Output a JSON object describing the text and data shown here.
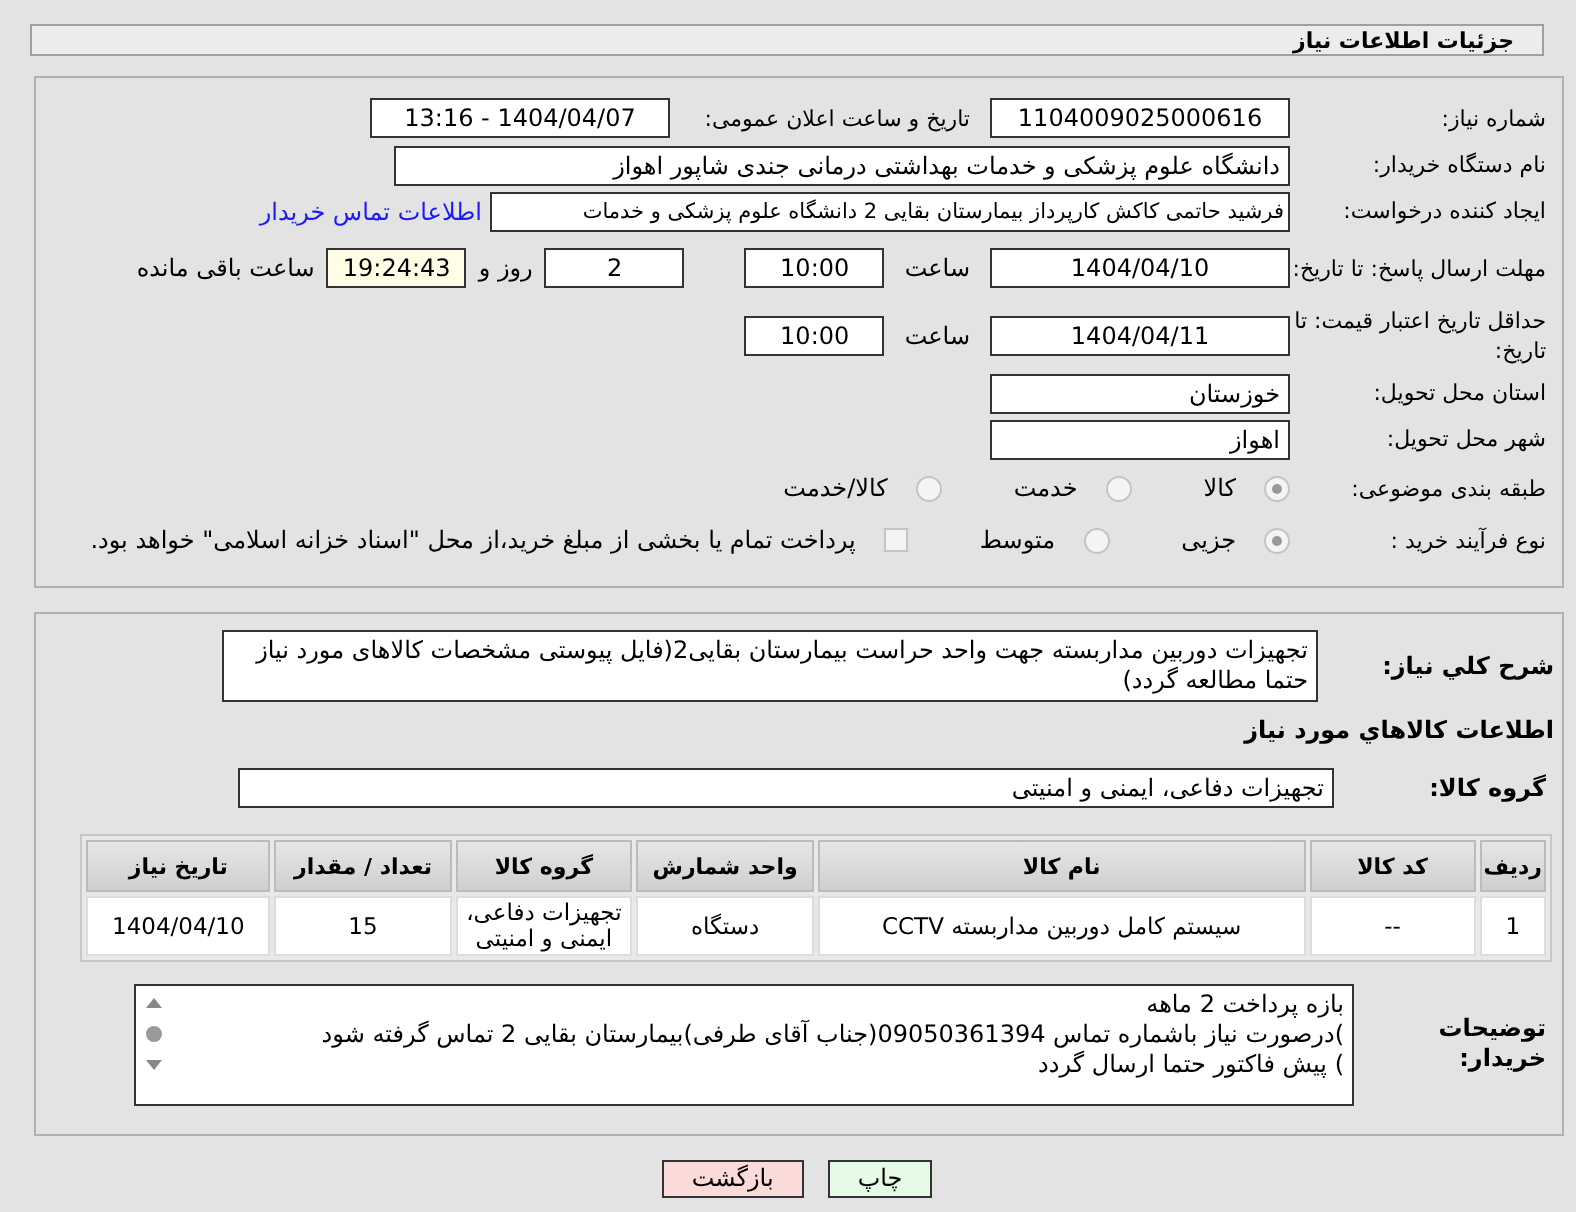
{
  "header": {
    "title": "جزئیات اطلاعات نیاز"
  },
  "details": {
    "need_number": {
      "label": "شماره نیاز:",
      "value": "1104009025000616"
    },
    "announce": {
      "label": "تاریخ و ساعت اعلان عمومی:",
      "value": "1404/04/07 - 13:16"
    },
    "buyer_org": {
      "label": "نام دستگاه خریدار:",
      "value": "دانشگاه علوم پزشکی و خدمات بهداشتی درمانی جندی شاپور اهواز"
    },
    "requester": {
      "label": "ایجاد کننده درخواست:",
      "value": "فرشید حاتمی کاکش کارپرداز بیمارستان بقایی 2 دانشگاه علوم پزشکی و خدمات",
      "link": "اطلاعات تماس خریدار"
    },
    "reply_deadline": {
      "label": "مهلت ارسال پاسخ: تا تاریخ:",
      "date": "1404/04/10",
      "time_label": "ساعت",
      "time": "10:00",
      "days": "2",
      "days_label": "روز و",
      "remaining": "19:24:43",
      "remaining_label": "ساعت باقی مانده"
    },
    "price_validity": {
      "label": "حداقل تاریخ اعتبار قیمت: تا تاریخ:",
      "date": "1404/04/11",
      "time_label": "ساعت",
      "time": "10:00"
    },
    "province": {
      "label": "استان محل تحویل:",
      "value": "خوزستان"
    },
    "city": {
      "label": "شهر محل تحویل:",
      "value": "اهواز"
    },
    "category": {
      "label": "طبقه بندی موضوعی:",
      "disabled": true,
      "options": [
        {
          "label": "کالا",
          "selected": true
        },
        {
          "label": "خدمت",
          "selected": false
        },
        {
          "label": "کالا/خدمت",
          "selected": false
        }
      ]
    },
    "process": {
      "label": "نوع فرآیند خرید :",
      "disabled": true,
      "options": [
        {
          "label": "جزیی",
          "selected": true
        },
        {
          "label": "متوسط",
          "selected": false
        }
      ],
      "treasury": {
        "label": "پرداخت تمام یا بخشی از مبلغ خرید،از محل \"اسناد خزانه اسلامی\" خواهد بود.",
        "checked": false
      }
    }
  },
  "need": {
    "label": "شرح کلي نياز:",
    "value": "تجهیزات دوربین مداربسته جهت واحد حراست بیمارستان بقایی2(فایل پیوستی مشخصات کالاهای مورد نیاز حتما مطالعه گردد)"
  },
  "goods": {
    "heading": "اطلاعات کالاهاي مورد نياز",
    "group_label": "گروه کالا:",
    "group_value": "تجهیزات دفاعی، ایمنی و امنیتی",
    "table": {
      "columns": [
        "ردیف",
        "کد کالا",
        "نام کالا",
        "واحد شمارش",
        "گروه کالا",
        "تعداد / مقدار",
        "تاریخ نیاز"
      ],
      "rows": [
        [
          "1",
          "--",
          "سیستم کامل دوربین مداربسته CCTV",
          "دستگاه",
          "تجهیزات دفاعی، ایمنی و امنیتی",
          "15",
          "1404/04/10"
        ]
      ]
    }
  },
  "buyer_notes": {
    "label": "توضیحات خریدار:",
    "lines": [
      "بازه پرداخت 2 ماهه",
      ")درصورت نیاز باشماره تماس 09050361394(جناب آقای طرفی)بیمارستان بقایی 2 تماس گرفته شود",
      ") پیش فاکتور حتما ارسال گردد"
    ]
  },
  "buttons": [
    {
      "label": "چاپ",
      "kind": "print"
    },
    {
      "label": "بازگشت",
      "kind": "back"
    }
  ]
}
